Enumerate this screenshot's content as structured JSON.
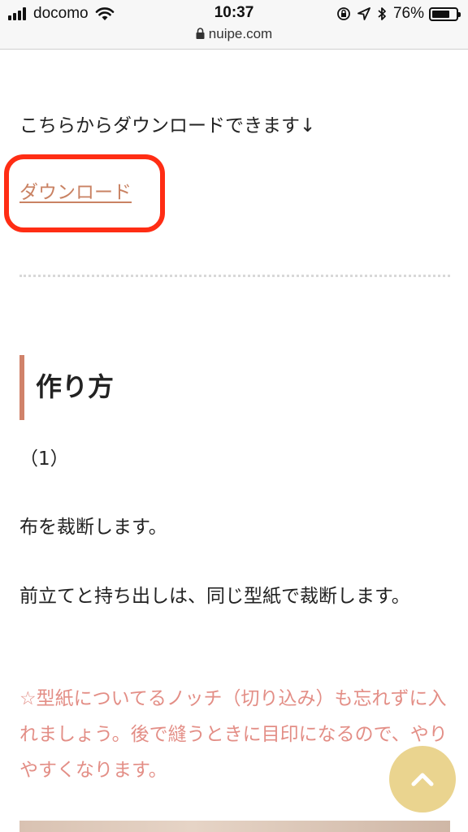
{
  "status_bar": {
    "carrier": "docomo",
    "time": "10:37",
    "battery_percent": "76%",
    "battery_level": 0.76,
    "icons": [
      "signal-icon",
      "wifi-icon",
      "rotation-lock-icon",
      "location-icon",
      "bluetooth-icon",
      "battery-icon"
    ]
  },
  "browser": {
    "url": "nuipe.com"
  },
  "article": {
    "download_intro": "こちらからダウンロードできます↓",
    "download_link": "ダウンロード",
    "heading": "作り方",
    "step_label": "（1）",
    "paragraph_1": "布を裁断します。",
    "paragraph_2": "前立てと持ち出しは、同じ型紙で裁断します。",
    "note": "☆型紙についてるノッチ（切り込み）も忘れずに入れましょう。後で縫うときに目印になるので、やりやすくなります。"
  },
  "colors": {
    "highlight_border": "#ff2d14",
    "link": "#c98263",
    "heading_accent": "#d0826a",
    "note_text": "#e38e86",
    "back_to_top_bg": "#ead48f"
  }
}
